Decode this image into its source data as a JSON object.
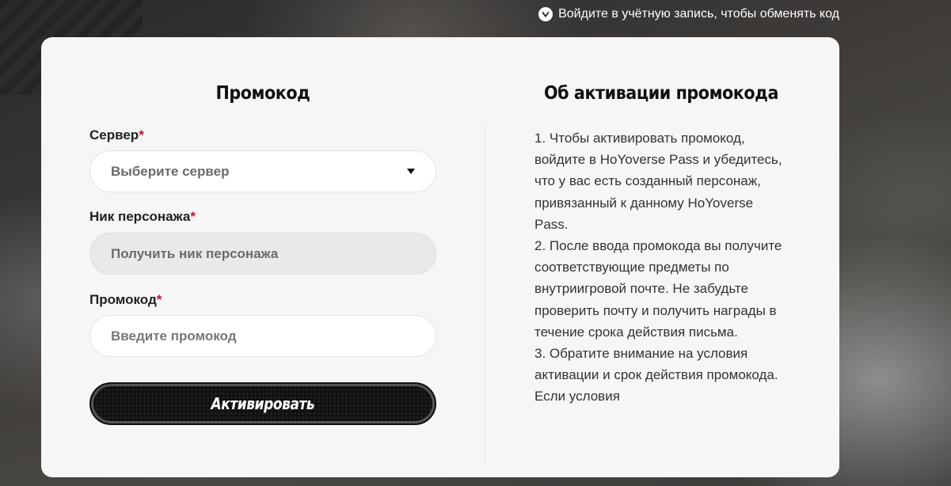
{
  "header": {
    "login_hint": "Войдите в учётную запись, чтобы обменять код"
  },
  "form": {
    "title": "Промокод",
    "server": {
      "label": "Сервер",
      "required_mark": "*",
      "placeholder": "Выберите сервер"
    },
    "nickname": {
      "label": "Ник персонажа",
      "required_mark": "*",
      "placeholder": "Получить ник персонажа"
    },
    "promo": {
      "label": "Промокод",
      "required_mark": "*",
      "placeholder": "Введите промокод"
    },
    "submit_label": "Активировать"
  },
  "info": {
    "title": "Об активации промокода",
    "text": "1. Чтобы активировать промокод, войдите в HoYoverse Pass и убедитесь, что у вас есть созданный персонаж, привязанный к данному HoYoverse Pass.\n2. После ввода промокода вы получите соответствующие предметы по внутриигровой почте. Не забудьте проверить почту и получить награды в течение срока действия письма.\n3. Обратите внимание на условия активации и срок действия промокода. Если условия"
  },
  "colors": {
    "required": "#c8102e",
    "card_bg": "#f6f6f6",
    "button_bg": "#111111"
  },
  "icons": {
    "login_hint": "hoyoverse-logo-icon",
    "server_dropdown": "caret-down-icon"
  }
}
